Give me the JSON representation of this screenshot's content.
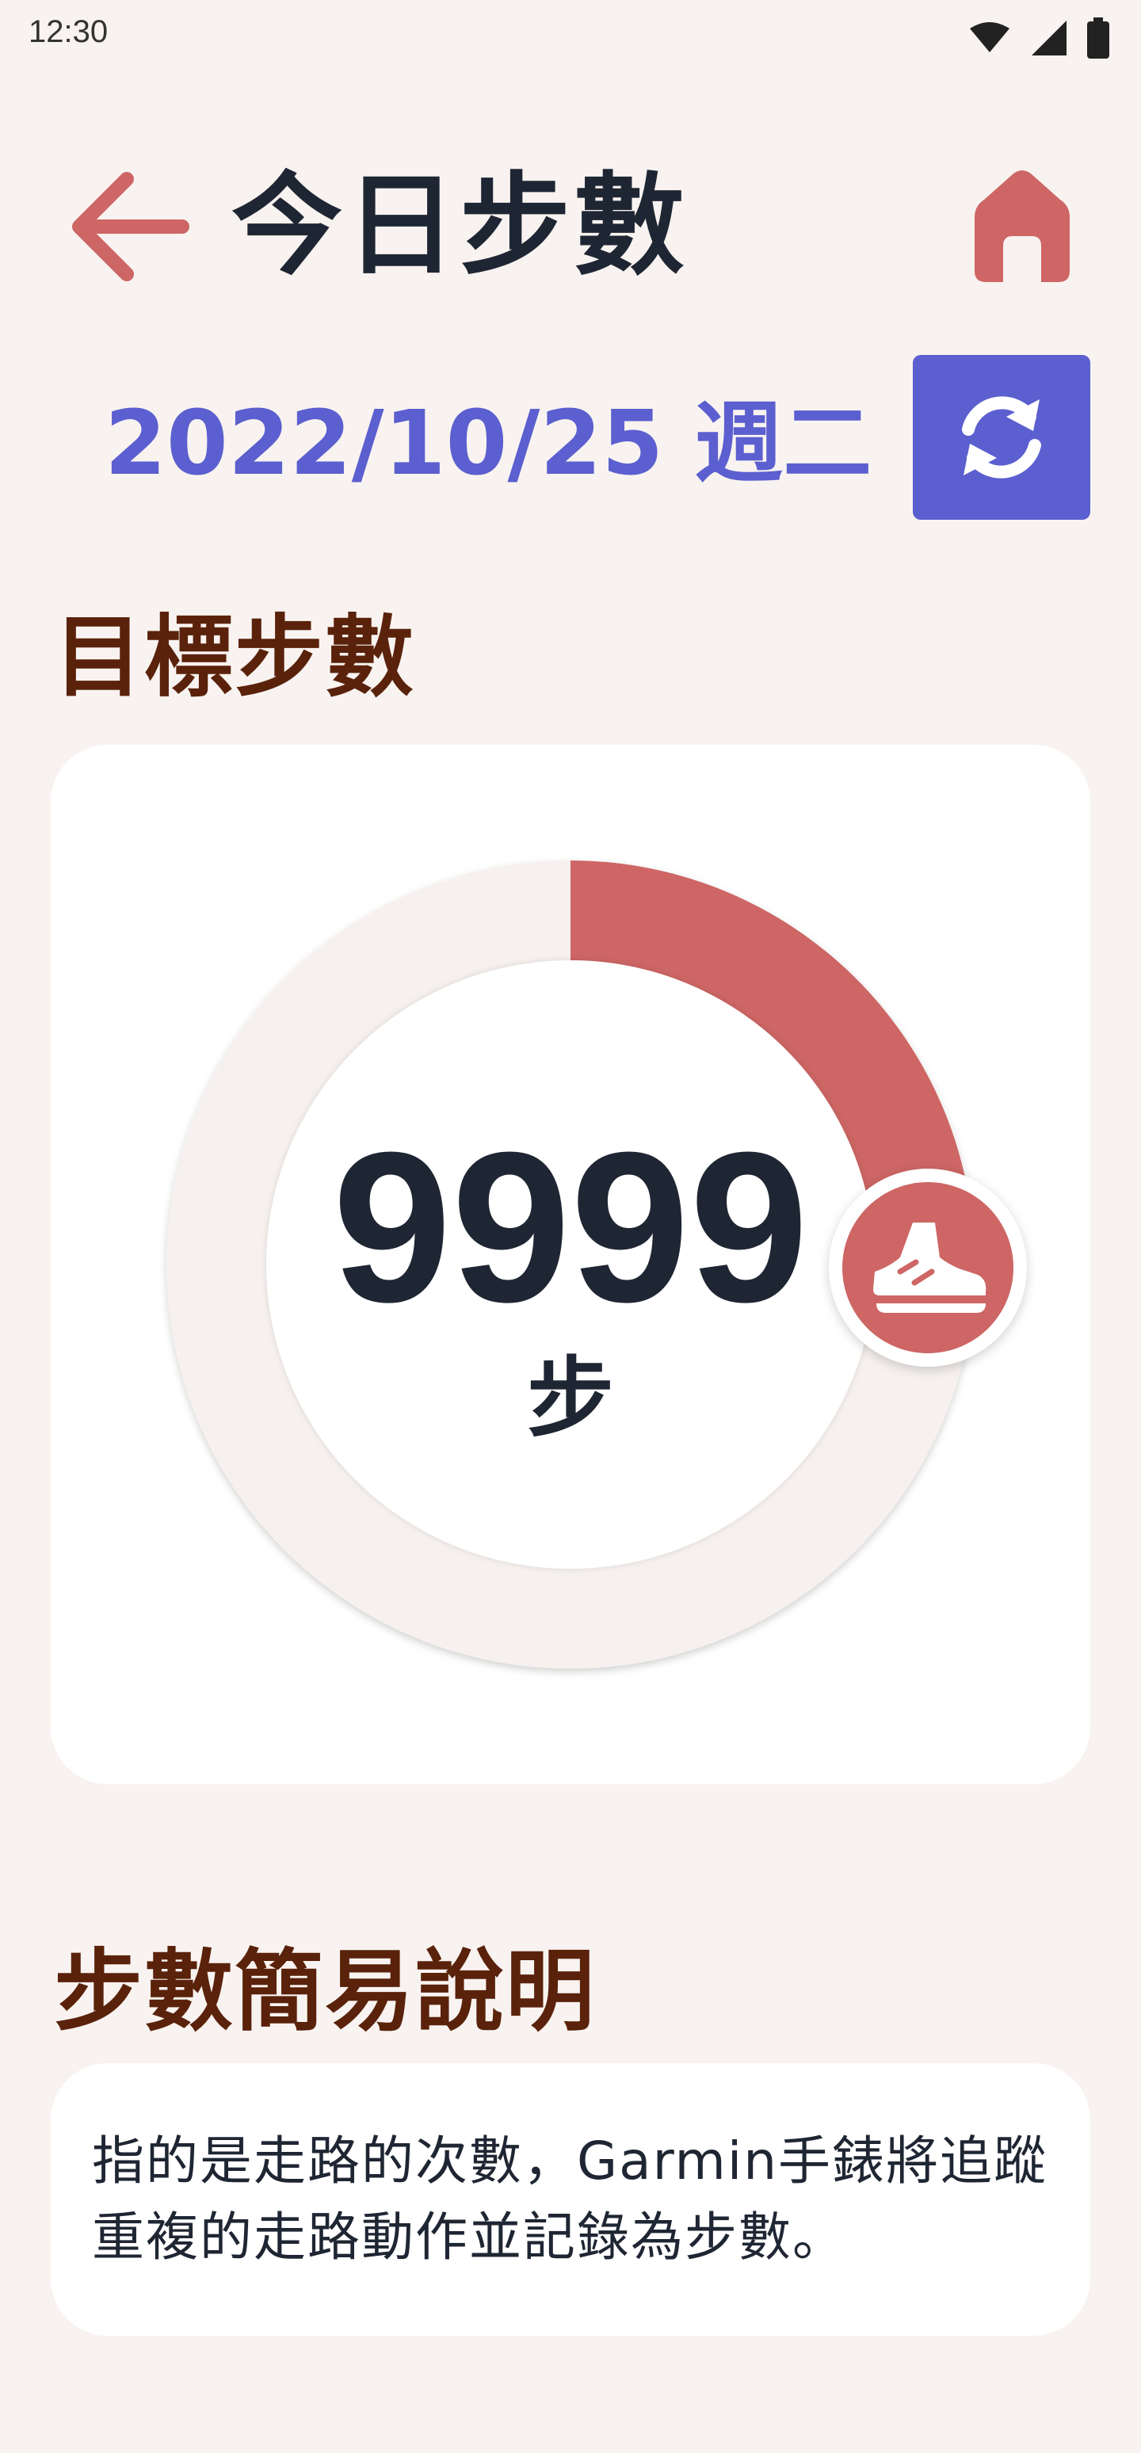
{
  "status_bar": {
    "time": "12:30",
    "icons": [
      "wifi-icon",
      "signal-icon",
      "battery-icon"
    ]
  },
  "header": {
    "title": "今日步數",
    "back_icon": "arrow-left-icon",
    "home_icon": "home-icon"
  },
  "date_row": {
    "date": "2022/10/25 週二",
    "refresh_icon": "refresh-icon"
  },
  "goal": {
    "heading": "目標步數",
    "steps": "9999",
    "unit": "步",
    "progress_fraction": 0.22,
    "badge_icon": "shoe-icon"
  },
  "info": {
    "heading": "步數簡易說明",
    "text": "指的是走路的次數，Garmin手錶將追蹤重複的走路動作並記錄為步數。"
  },
  "colors": {
    "background": "#f8f3f0",
    "accent_red": "#cd6664",
    "accent_blue": "#5b5fcf",
    "heading_brown": "#5a220b",
    "text_dark": "#1f2633",
    "ring_track": "#f6f1ee"
  }
}
